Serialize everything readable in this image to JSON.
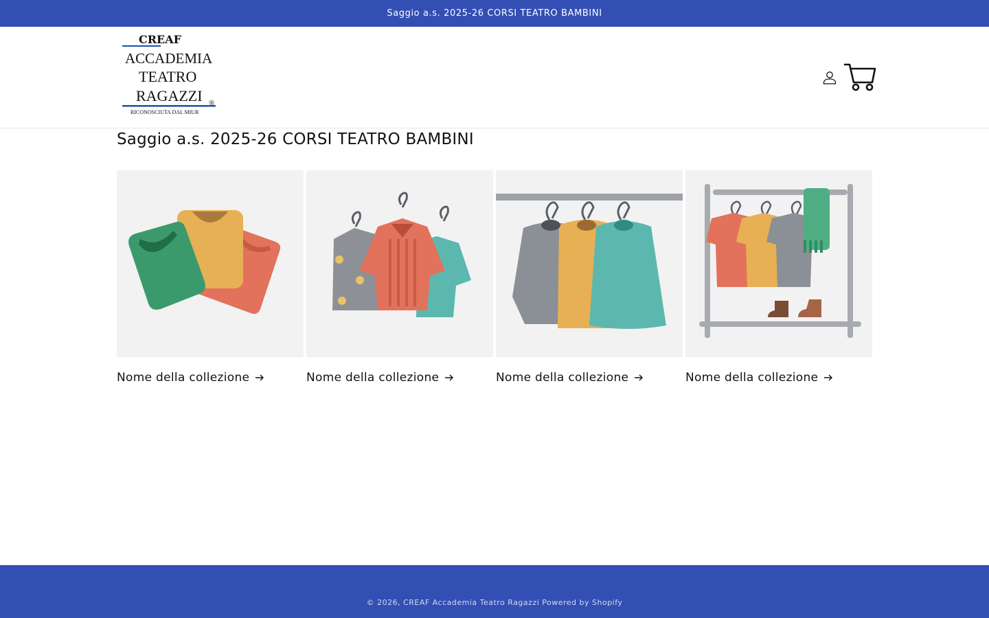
{
  "announcement": {
    "text": "Saggio a.s. 2025-26 CORSI TEATRO BAMBINI"
  },
  "header": {
    "logo": {
      "line1": "CREAF",
      "line2": "ACCADEMIA",
      "line3": "TEATRO",
      "line4": "RAGAZZI",
      "line5": "RICONOSCIUTA DAL MIUR",
      "mark": "®"
    },
    "account_icon": "user-icon",
    "cart_icon": "cart-icon"
  },
  "main": {
    "title": "Saggio a.s. 2025-26 CORSI TEATRO BAMBINI",
    "collections": [
      {
        "label": "Nome della collezione",
        "illustration": "folded-shirts"
      },
      {
        "label": "Nome della collezione",
        "illustration": "hanging-shirts"
      },
      {
        "label": "Nome della collezione",
        "illustration": "sweaters-on-rail"
      },
      {
        "label": "Nome della collezione",
        "illustration": "clothing-rack"
      }
    ]
  },
  "footer": {
    "copyright": "© 2026, CREAF Accademia Teatro Ragazzi Powered by Shopify"
  },
  "colors": {
    "brand": "#334fb4",
    "text": "#121212",
    "card_bg": "#f2f2f2"
  }
}
